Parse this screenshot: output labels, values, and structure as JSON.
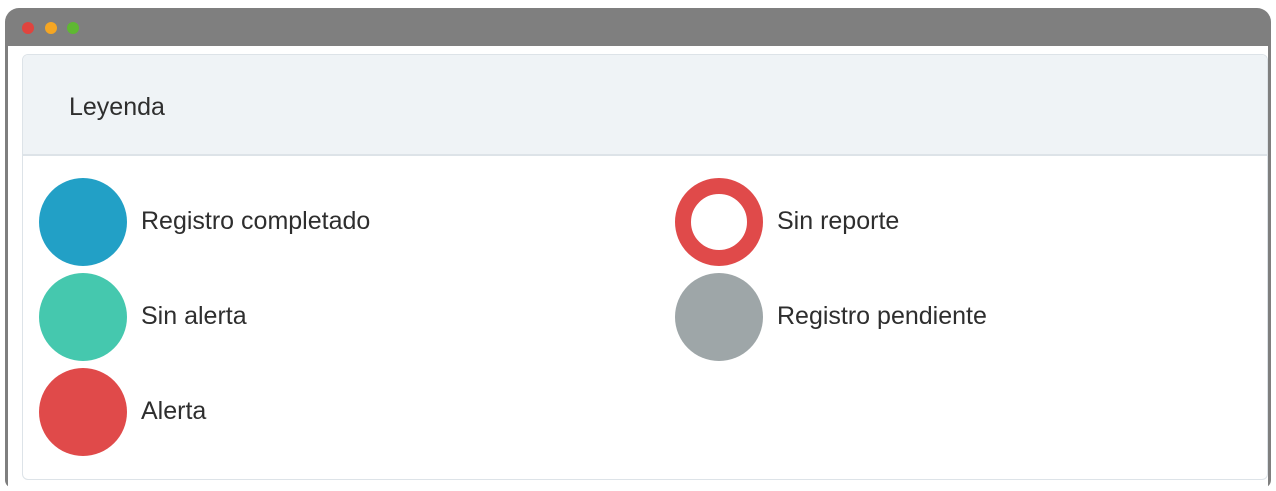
{
  "window": {
    "controls": [
      {
        "name": "close",
        "color": "#e0443e"
      },
      {
        "name": "minimize",
        "color": "#f5a623"
      },
      {
        "name": "maximize",
        "color": "#5fb832"
      }
    ]
  },
  "legend": {
    "title": "Leyenda",
    "items": [
      {
        "label": "Registro completado",
        "color": "#22a0c6",
        "style": "filled"
      },
      {
        "label": "Sin alerta",
        "color": "#45c8ae",
        "style": "filled"
      },
      {
        "label": "Alerta",
        "color": "#e04a4a",
        "style": "filled"
      },
      {
        "label": "Sin reporte",
        "color": "#e04a4a",
        "style": "ring"
      },
      {
        "label": "Registro pendiente",
        "color": "#9ea6a8",
        "style": "filled"
      }
    ]
  }
}
